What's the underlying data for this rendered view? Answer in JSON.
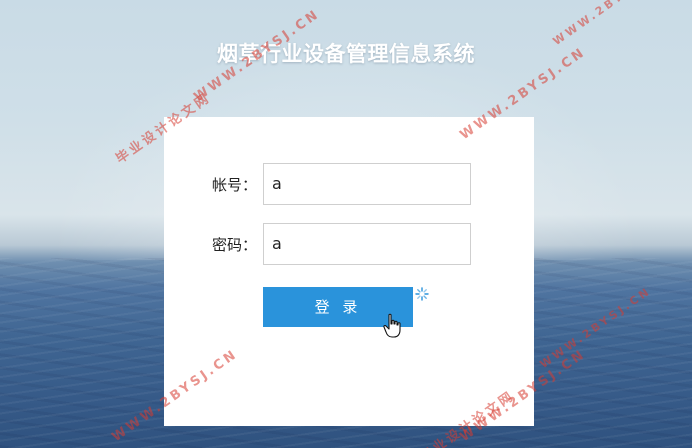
{
  "page": {
    "title": "烟草行业设备管理信息系统"
  },
  "login": {
    "account_label": "帐号：",
    "account_value": "a",
    "password_label": "密码：",
    "password_value": "a",
    "submit_label": "登 录"
  },
  "watermarks": [
    "WWW.2BYSJ.CN",
    "毕业设计论文网",
    "WWW.2BYSJ.CN",
    "WWW.2BYSJ.CN",
    "WWW.2BYSJ.CN",
    "WWW.2BYSJ.CN",
    "毕业设计论文网",
    "WWW.2BYSJ.CN"
  ],
  "colors": {
    "button": "#2a93db",
    "watermark": "#d73c32"
  },
  "icons": {
    "spinner": "loading-spinner-icon",
    "cursor": "hand-pointer-icon"
  }
}
